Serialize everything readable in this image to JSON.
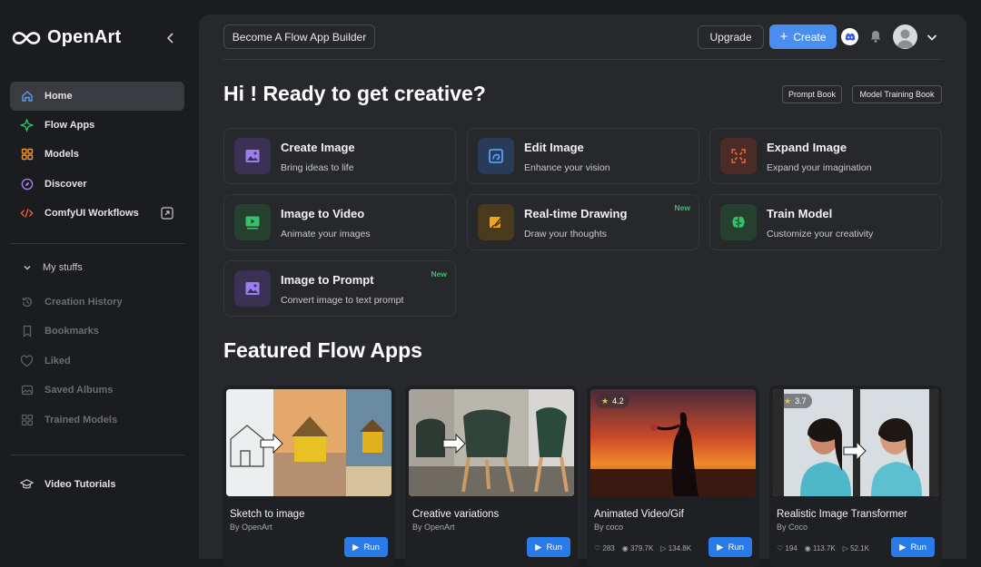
{
  "brand": {
    "name": "OpenArt"
  },
  "sidebar": {
    "items": [
      {
        "label": "Home"
      },
      {
        "label": "Flow Apps"
      },
      {
        "label": "Models"
      },
      {
        "label": "Discover"
      },
      {
        "label": "ComfyUI Workflows"
      }
    ],
    "my_stuffs_label": "My stuffs",
    "stuff_items": [
      {
        "label": "Creation History"
      },
      {
        "label": "Bookmarks"
      },
      {
        "label": "Liked"
      },
      {
        "label": "Saved Albums"
      },
      {
        "label": "Trained Models"
      }
    ],
    "tutorials_label": "Video Tutorials"
  },
  "header": {
    "builder_label": "Become A Flow App Builder",
    "upgrade_label": "Upgrade",
    "create_label": "Create"
  },
  "main": {
    "greeting": "Hi ! Ready to get creative?",
    "prompt_book": "Prompt Book",
    "model_training_book": "Model Training Book",
    "tools": [
      {
        "title": "Create Image",
        "subtitle": "Bring ideas to life",
        "icon": "image-icon",
        "color": "#8a6cf0"
      },
      {
        "title": "Edit Image",
        "subtitle": "Enhance your vision",
        "icon": "edit-image-icon",
        "color": "#4a8ef0"
      },
      {
        "title": "Expand Image",
        "subtitle": "Expand your imagination",
        "icon": "expand-icon",
        "color": "#e8643c"
      },
      {
        "title": "Image to Video",
        "subtitle": "Animate your images",
        "icon": "video-icon",
        "color": "#36c26b"
      },
      {
        "title": "Real-time Drawing",
        "subtitle": "Draw your thoughts",
        "icon": "brush-icon",
        "color": "#f0a51c",
        "badge": "New"
      },
      {
        "title": "Train Model",
        "subtitle": "Customize your creativity",
        "icon": "brain-icon",
        "color": "#36c26b"
      },
      {
        "title": "Image to Prompt",
        "subtitle": "Convert image to text prompt",
        "icon": "image-prompt-icon",
        "color": "#8a6cf0",
        "badge": "New"
      }
    ],
    "featured_title": "Featured Flow Apps",
    "apps": [
      {
        "name": "Sketch to image",
        "by": "By OpenArt",
        "run": "Run"
      },
      {
        "name": "Creative variations",
        "by": "By OpenArt",
        "run": "Run"
      },
      {
        "name": "Animated Video/Gif",
        "by": "By coco",
        "run": "Run",
        "rating": "4.2",
        "likes": "283",
        "views": "379.7K",
        "runs": "134.8K"
      },
      {
        "name": "Realistic Image Transformer",
        "by": "By Coco",
        "run": "Run",
        "rating": "3.7",
        "likes": "194",
        "views": "113.7K",
        "runs": "52.1K"
      }
    ]
  }
}
